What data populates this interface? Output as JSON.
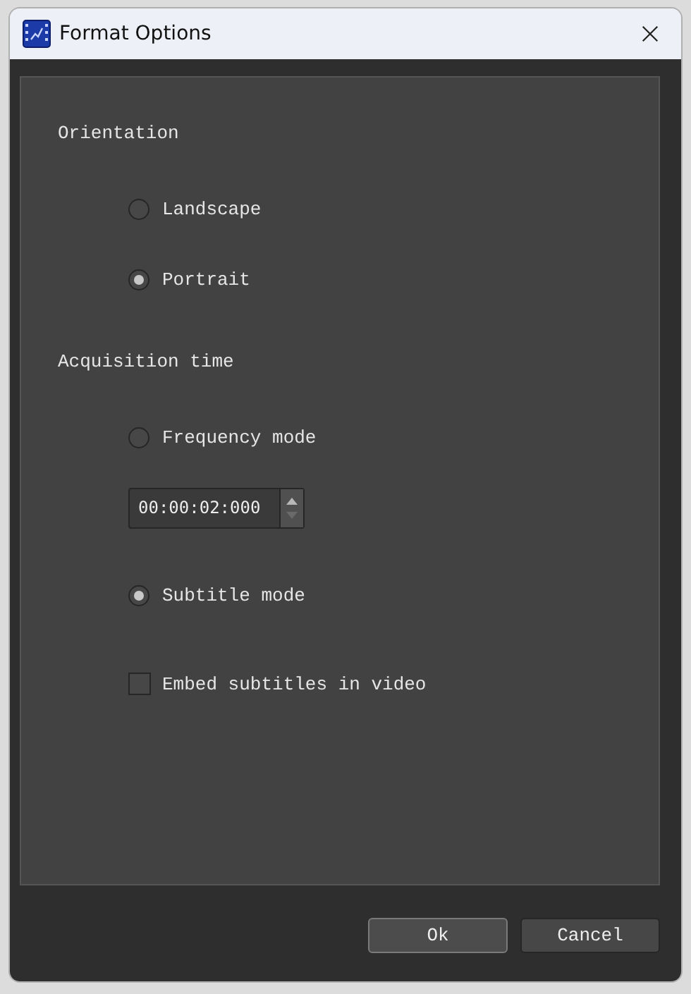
{
  "window": {
    "title": "Format Options"
  },
  "sections": [
    {
      "heading": "Orientation",
      "items": [
        {
          "kind": "radio",
          "label": "Landscape",
          "selected": false
        },
        {
          "kind": "radio",
          "label": "Portrait",
          "selected": true
        }
      ]
    },
    {
      "heading": "Acquisition time",
      "items": [
        {
          "kind": "radio",
          "label": "Frequency mode",
          "selected": false
        },
        {
          "kind": "spinbox",
          "value": "00:00:02:000"
        },
        {
          "kind": "radio",
          "label": "Subtitle mode",
          "selected": true
        },
        {
          "kind": "checkbox",
          "label": "Embed subtitles in video",
          "checked": false
        }
      ]
    }
  ],
  "buttons": [
    {
      "label": "Ok",
      "default": true
    },
    {
      "label": "Cancel",
      "default": false
    }
  ]
}
